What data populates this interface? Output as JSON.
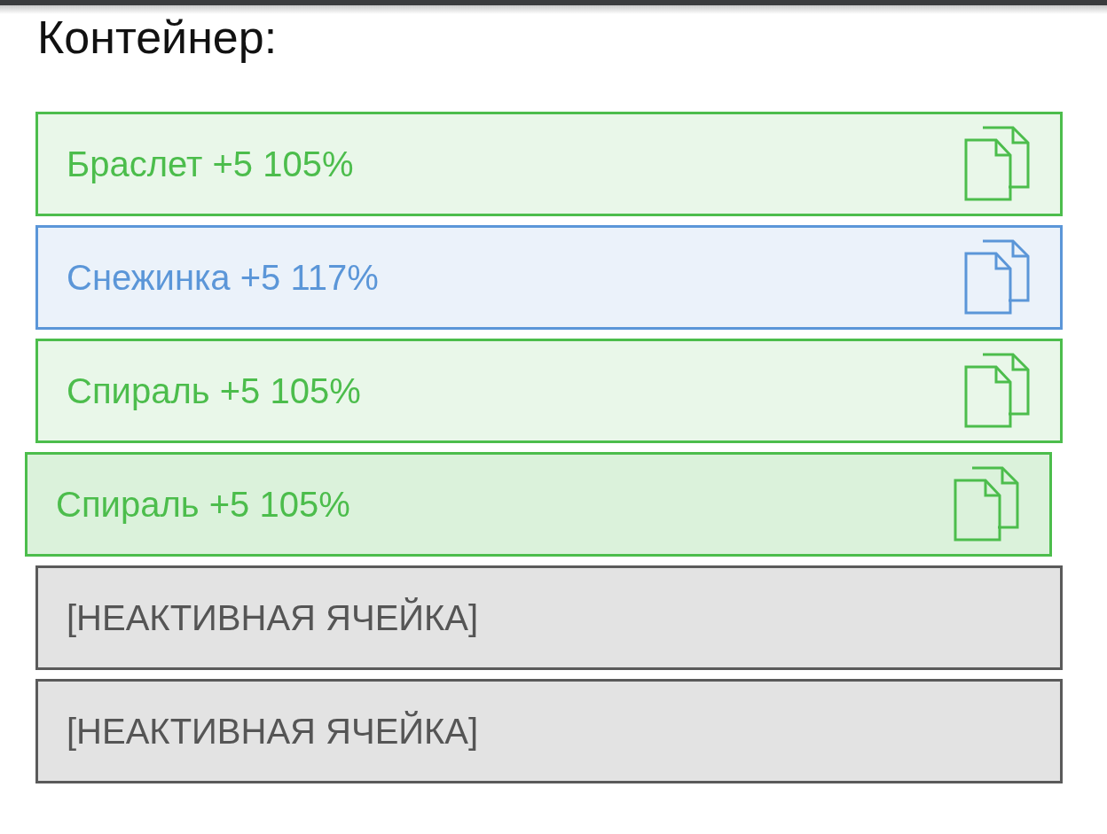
{
  "title": "Контейнер:",
  "cells": [
    {
      "kind": "item",
      "label": "Браслет +5 105%",
      "color": "#4cbd4c",
      "dragging": false
    },
    {
      "kind": "item",
      "label": "Снежинка +5 117%",
      "color": "#5b96d8",
      "dragging": false
    },
    {
      "kind": "item",
      "label": "Спираль +5 105%",
      "color": "#4cbd4c",
      "dragging": false
    },
    {
      "kind": "item",
      "label": "Спираль +5 105%",
      "color": "#4cbd4c",
      "dragging": true
    },
    {
      "kind": "inactive",
      "label": "[НЕАКТИВНАЯ ЯЧЕЙКА]"
    },
    {
      "kind": "inactive",
      "label": "[НЕАКТИВНАЯ ЯЧЕЙКА]"
    }
  ]
}
